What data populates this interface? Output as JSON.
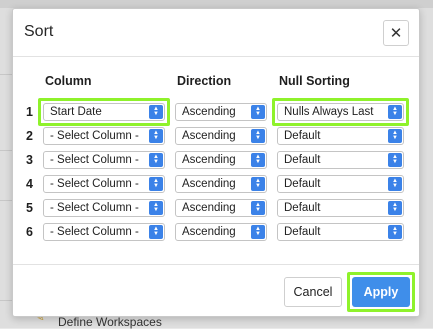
{
  "background": {
    "workspace_label": "Define Workspaces"
  },
  "dialog": {
    "title": "Sort",
    "close_glyph": "✕",
    "columns": {
      "column": "Column",
      "direction": "Direction",
      "null_sorting": "Null Sorting"
    },
    "rows": [
      {
        "num": "1",
        "column": "Start Date",
        "direction": "Ascending",
        "null_sorting": "Nulls Always Last"
      },
      {
        "num": "2",
        "column": "- Select Column -",
        "direction": "Ascending",
        "null_sorting": "Default"
      },
      {
        "num": "3",
        "column": "- Select Column -",
        "direction": "Ascending",
        "null_sorting": "Default"
      },
      {
        "num": "4",
        "column": "- Select Column -",
        "direction": "Ascending",
        "null_sorting": "Default"
      },
      {
        "num": "5",
        "column": "- Select Column -",
        "direction": "Ascending",
        "null_sorting": "Default"
      },
      {
        "num": "6",
        "column": "- Select Column -",
        "direction": "Ascending",
        "null_sorting": "Default"
      }
    ],
    "cancel_label": "Cancel",
    "apply_label": "Apply"
  },
  "colors": {
    "accent": "#3f8eea",
    "highlight": "#8ff22b"
  },
  "icons": {
    "select_arrow": "chevron-updown-icon",
    "close": "close-icon",
    "background_edit": "pencil-icon"
  }
}
